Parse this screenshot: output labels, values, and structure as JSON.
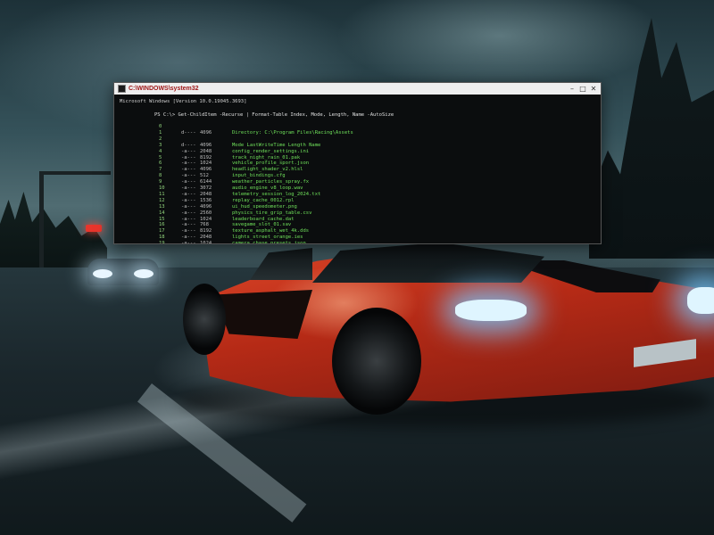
{
  "terminal": {
    "title": "C:\\WINDOWS\\system32",
    "controls": {
      "minimize": "–",
      "maximize": "□",
      "close": "✕"
    },
    "path_line": "Microsoft Windows [Version 10.0.19045.3693]",
    "command": "PS C:\\> Get-ChildItem -Recurse | Format-Table Index, Mode, Length, Name -AutoSize",
    "rows": [
      {
        "idx": "0",
        "a": "",
        "b": "",
        "text": ""
      },
      {
        "idx": "1",
        "a": "d----",
        "b": "4096",
        "text": "Directory: C:\\Program Files\\Racing\\Assets"
      },
      {
        "idx": "2",
        "a": "",
        "b": "",
        "text": ""
      },
      {
        "idx": "3",
        "a": "d----",
        "b": "4096",
        "text": "Mode  LastWriteTime  Length  Name"
      },
      {
        "idx": "4",
        "a": "-a---",
        "b": "2048",
        "text": "config_render_settings.ini"
      },
      {
        "idx": "5",
        "a": "-a---",
        "b": "8192",
        "text": "track_night_rain_01.pak"
      },
      {
        "idx": "6",
        "a": "-a---",
        "b": "1024",
        "text": "vehicle_profile_sport.json"
      },
      {
        "idx": "7",
        "a": "-a---",
        "b": "4096",
        "text": "headlight_shader_v2.hlsl"
      },
      {
        "idx": "8",
        "a": "-a---",
        "b": "512",
        "text": "input_bindings.cfg"
      },
      {
        "idx": "9",
        "a": "-a---",
        "b": "6144",
        "text": "weather_particles_spray.fx"
      },
      {
        "idx": "10",
        "a": "-a---",
        "b": "3072",
        "text": "audio_engine_v8_loop.wav"
      },
      {
        "idx": "11",
        "a": "-a---",
        "b": "2048",
        "text": "telemetry_session_log_2024.txt"
      },
      {
        "idx": "12",
        "a": "-a---",
        "b": "1536",
        "text": "replay_cache_0012.rpl"
      },
      {
        "idx": "13",
        "a": "-a---",
        "b": "4096",
        "text": "ui_hud_speedometer.png"
      },
      {
        "idx": "14",
        "a": "-a---",
        "b": "2560",
        "text": "physics_tire_grip_table.csv"
      },
      {
        "idx": "15",
        "a": "-a---",
        "b": "1024",
        "text": "leaderboard_cache.dat"
      },
      {
        "idx": "16",
        "a": "-a---",
        "b": "768",
        "text": "savegame_slot_01.sav"
      },
      {
        "idx": "17",
        "a": "-a---",
        "b": "8192",
        "text": "texture_asphalt_wet_4k.dds"
      },
      {
        "idx": "18",
        "a": "-a---",
        "b": "2048",
        "text": "lights_street_orange.ies"
      },
      {
        "idx": "19",
        "a": "-a---",
        "b": "1024",
        "text": "camera_chase_presets.json"
      },
      {
        "idx": "20",
        "a": "-a---",
        "b": "512",
        "text": "version.txt"
      }
    ]
  },
  "wallpaper": {
    "description_icon": "sports-car-wallpaper"
  }
}
